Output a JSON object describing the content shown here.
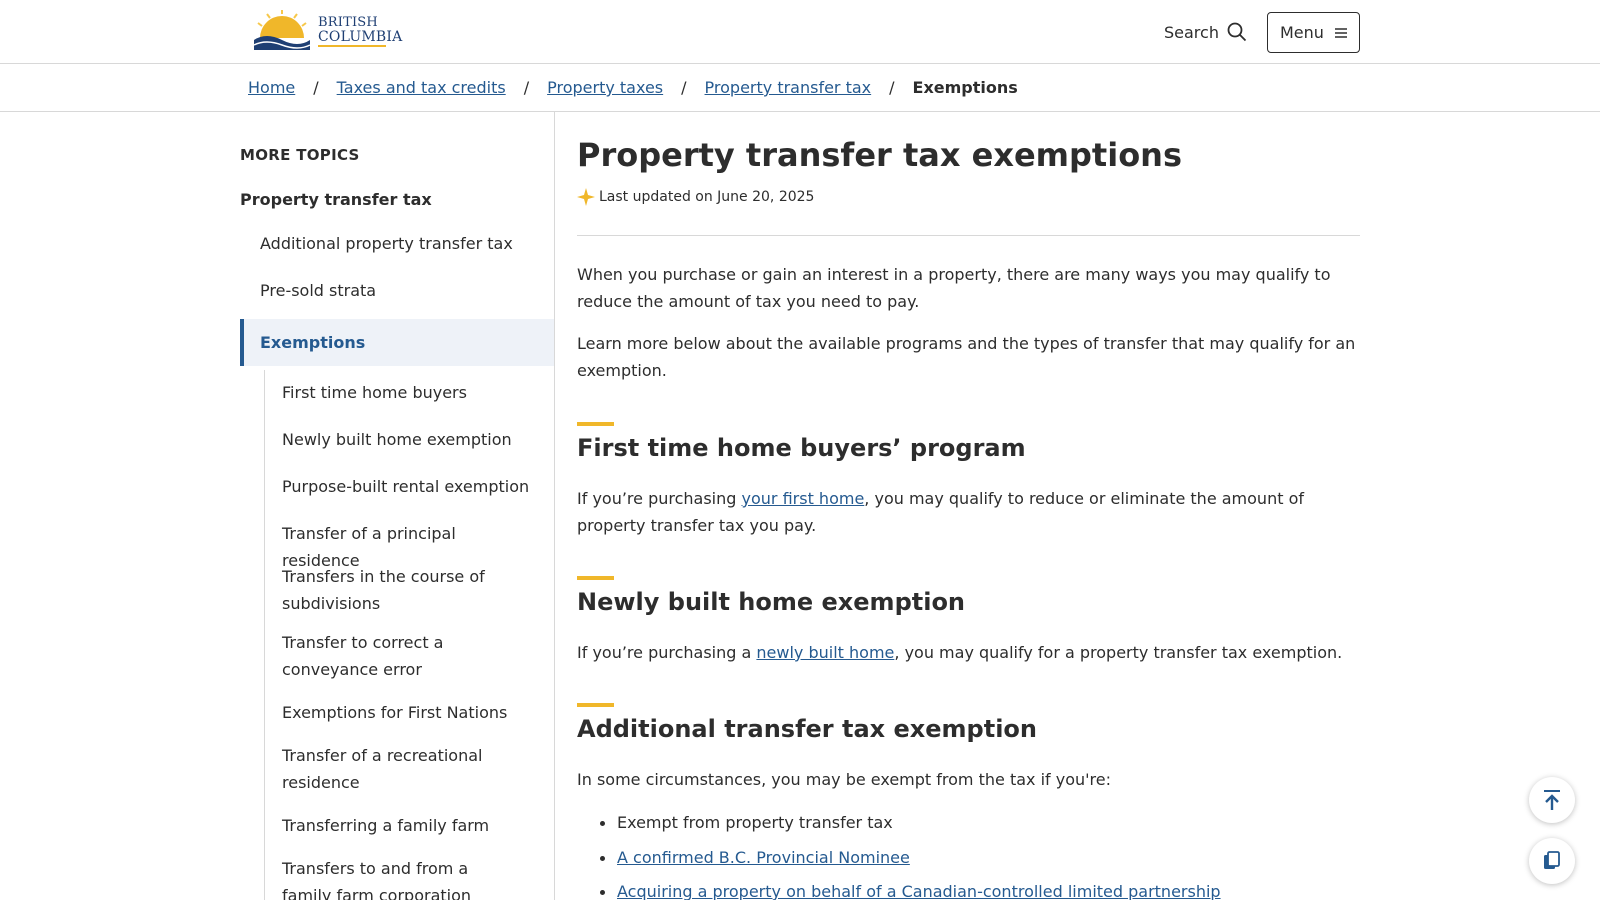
{
  "header": {
    "logo_line1": "BRITISH",
    "logo_line2": "COLUMBIA",
    "search_label": "Search",
    "menu_label": "Menu"
  },
  "breadcrumb": {
    "items": [
      "Home",
      "Taxes and tax credits",
      "Property taxes",
      "Property transfer tax"
    ],
    "current": "Exemptions",
    "separator": "/"
  },
  "sidebar": {
    "heading": "MORE TOPICS",
    "parent": "Property transfer tax",
    "items": [
      "Additional property transfer tax",
      "Pre-sold strata"
    ],
    "active": "Exemptions",
    "subitems": [
      "First time home buyers",
      "Newly built home exemption",
      "Purpose-built rental exemption",
      "Transfer of a principal residence",
      "Transfers in the course of subdivisions",
      "Transfer to correct a conveyance error",
      "Exemptions for First Nations",
      "Transfer of a recreational residence",
      "Transferring a family farm",
      "Transfers to and from a family farm corporation"
    ]
  },
  "main": {
    "title": "Property transfer tax exemptions",
    "updated": "Last updated on June 20, 2025",
    "intro1": "When you purchase or gain an interest in a property, there are many ways you may qualify to reduce the amount of tax you need to pay.",
    "intro2": "Learn more below about the available programs and the types of transfer that may qualify for an exemption.",
    "sections": [
      {
        "heading": "First time home buyers’ program",
        "text_before": "If you’re purchasing ",
        "link": "your first home",
        "text_after": ", you may qualify to reduce or eliminate the amount of property transfer tax you pay."
      },
      {
        "heading": "Newly built home exemption",
        "text_before": "If you’re purchasing a ",
        "link": "newly built home",
        "text_after": ", you may qualify for a property transfer tax exemption."
      },
      {
        "heading": "Additional transfer tax exemption",
        "text": "In some circumstances, you may be exempt from the tax if you're:",
        "list": [
          "Exempt from property transfer tax",
          "A confirmed B.C. Provincial Nominee",
          "Acquiring a property on behalf of a Canadian-controlled limited partnership"
        ]
      }
    ]
  },
  "colors": {
    "link": "#255a90",
    "accent": "#f0b72a",
    "text": "#2d2d2d",
    "active_bg": "#eef2f8"
  },
  "icons": {
    "search": "search-icon",
    "menu": "hamburger-icon",
    "updated": "sparkle-icon",
    "back_to_top": "arrow-up-icon",
    "copy": "copy-icon"
  }
}
